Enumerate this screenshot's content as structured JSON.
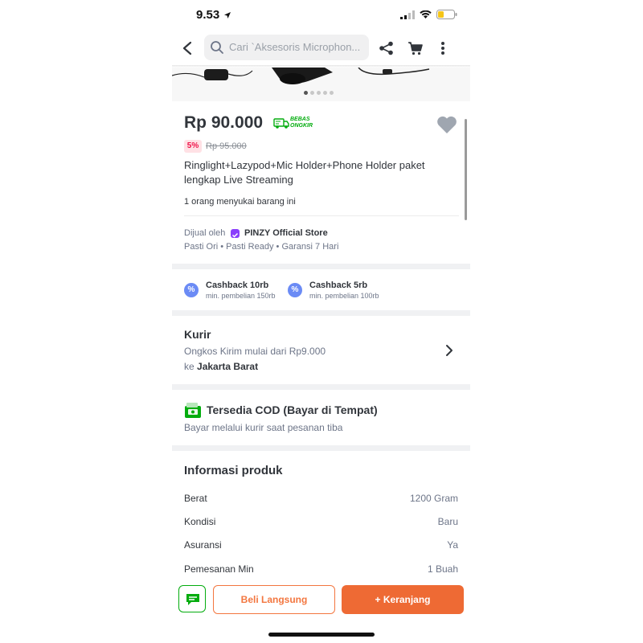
{
  "status_bar": {
    "time": "9.53"
  },
  "header": {
    "search_placeholder": "Cari `Aksesoris Microphon..."
  },
  "product": {
    "price": "Rp 90.000",
    "free_shipping_badge": "BEBAS ONGKIR",
    "discount": "5%",
    "original_price": "Rp 95.000",
    "title": "Ringlight+Lazypod+Mic Holder+Phone Holder paket lengkap Live Streaming",
    "likes": "1 orang menyukai barang ini",
    "image_pages": 5,
    "active_image": 1
  },
  "seller": {
    "label": "Dijual oleh",
    "name": "PINZY Official Store",
    "features": [
      "Pasti Ori",
      "Pasti Ready",
      "Garansi 7 Hari"
    ]
  },
  "cashback": [
    {
      "title": "Cashback 10rb",
      "subtitle": "min. pembelian 150rb"
    },
    {
      "title": "Cashback 5rb",
      "subtitle": "min. pembelian 100rb"
    }
  ],
  "courier": {
    "title": "Kurir",
    "line1": "Ongkos Kirim mulai dari Rp9.000",
    "line2_prefix": "ke",
    "destination": "Jakarta Barat"
  },
  "cod": {
    "title": "Tersedia COD (Bayar di Tempat)",
    "subtitle": "Bayar melalui kurir saat pesanan tiba"
  },
  "info": {
    "title": "Informasi produk",
    "rows": [
      {
        "key": "Berat",
        "value": "1200 Gram"
      },
      {
        "key": "Kondisi",
        "value": "Baru"
      },
      {
        "key": "Asuransi",
        "value": "Ya"
      },
      {
        "key": "Pemesanan Min",
        "value": "1 Buah"
      }
    ]
  },
  "actions": {
    "buy_now": "Beli Langsung",
    "add_to_cart": "+ Keranjang"
  },
  "colors": {
    "brand_green": "#03ac0e",
    "orange": "#ee6a34",
    "discount_red": "#ef144a"
  }
}
